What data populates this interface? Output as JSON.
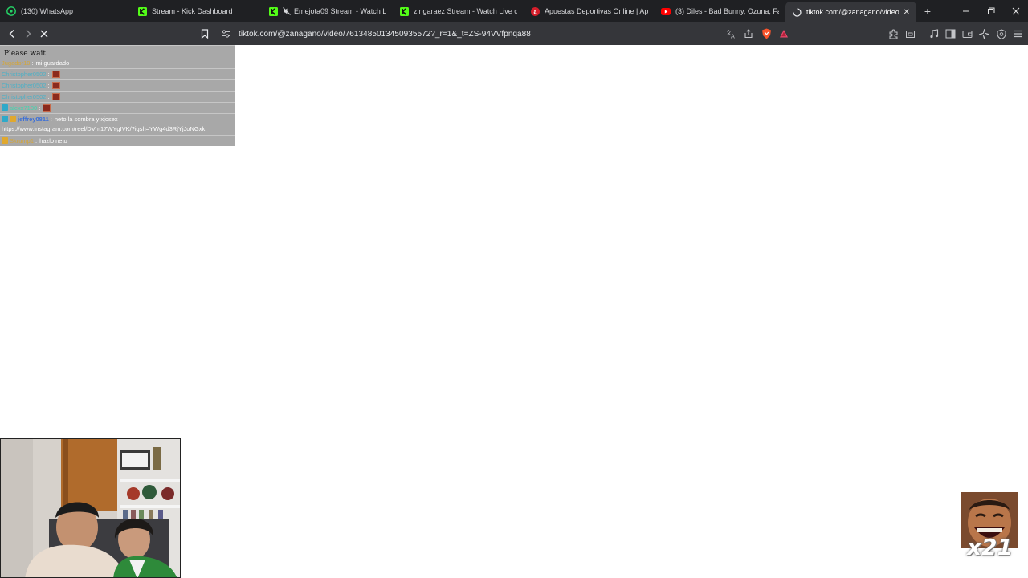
{
  "tabs": [
    {
      "title": "(130) WhatsApp",
      "favicon": "whatsapp-icon",
      "color": "#25d366"
    },
    {
      "title": "Stream - Kick Dashboard",
      "favicon": "kick-icon",
      "color": "#53fc18"
    },
    {
      "title": "Emejota09 Stream - Watch Live o",
      "favicon": "kick-icon",
      "color": "#53fc18",
      "muted": true
    },
    {
      "title": "zingaraez Stream - Watch Live on Ki",
      "favicon": "kick-icon",
      "color": "#53fc18"
    },
    {
      "title": "Apuestas Deportivas Online | Apuest",
      "favicon": "betting-icon",
      "color": "#d61e2b"
    },
    {
      "title": "(3) Diles - Bad Bunny, Ozuna, Farruk",
      "favicon": "youtube-icon",
      "color": "#ff0000"
    },
    {
      "title": "tiktok.com/@zanagano/video/7",
      "favicon": "loading-icon",
      "color": "#e8eaed",
      "active": true
    }
  ],
  "toolbar": {
    "url": "tiktok.com/@zanagano/video/7613485013450935572?_r=1&_t=ZS-94VVfpnqa88"
  },
  "page": {
    "status": "Please wait"
  },
  "chat": {
    "messages": [
      {
        "user": "Jugador10",
        "user_color": "#d4a63a",
        "text": "mi guardado"
      },
      {
        "user": "Christopher0502",
        "user_color": "#4fb0c6",
        "text": ""
      },
      {
        "user": "Christopher0502",
        "user_color": "#4fb0c6",
        "text": ""
      },
      {
        "user": "Christopher0502",
        "user_color": "#4fb0c6",
        "text": ""
      },
      {
        "user": "alexx7100",
        "user_color": "#3fd7b0",
        "text": ""
      },
      {
        "user": "jeffrey0811",
        "user_color": "#3a6fd8",
        "text": "neto la sombra y xjosex"
      },
      {
        "user": "",
        "user_color": "#ffffff",
        "text": "https://www.instagram.com/reel/DVm17WYgIVK/?igsh=YWg4d3RjYjJoNGxk"
      },
      {
        "user": "Skrump1",
        "user_color": "#d4a63a",
        "text": "hazlo neto"
      }
    ]
  },
  "overlay": {
    "emote_count": "x21"
  },
  "colors": {
    "tabstrip_bg": "#1f2023",
    "toolbar_bg": "#35363a",
    "chat_bg": "#a8a8a8",
    "page_bg": "#ffffff"
  }
}
